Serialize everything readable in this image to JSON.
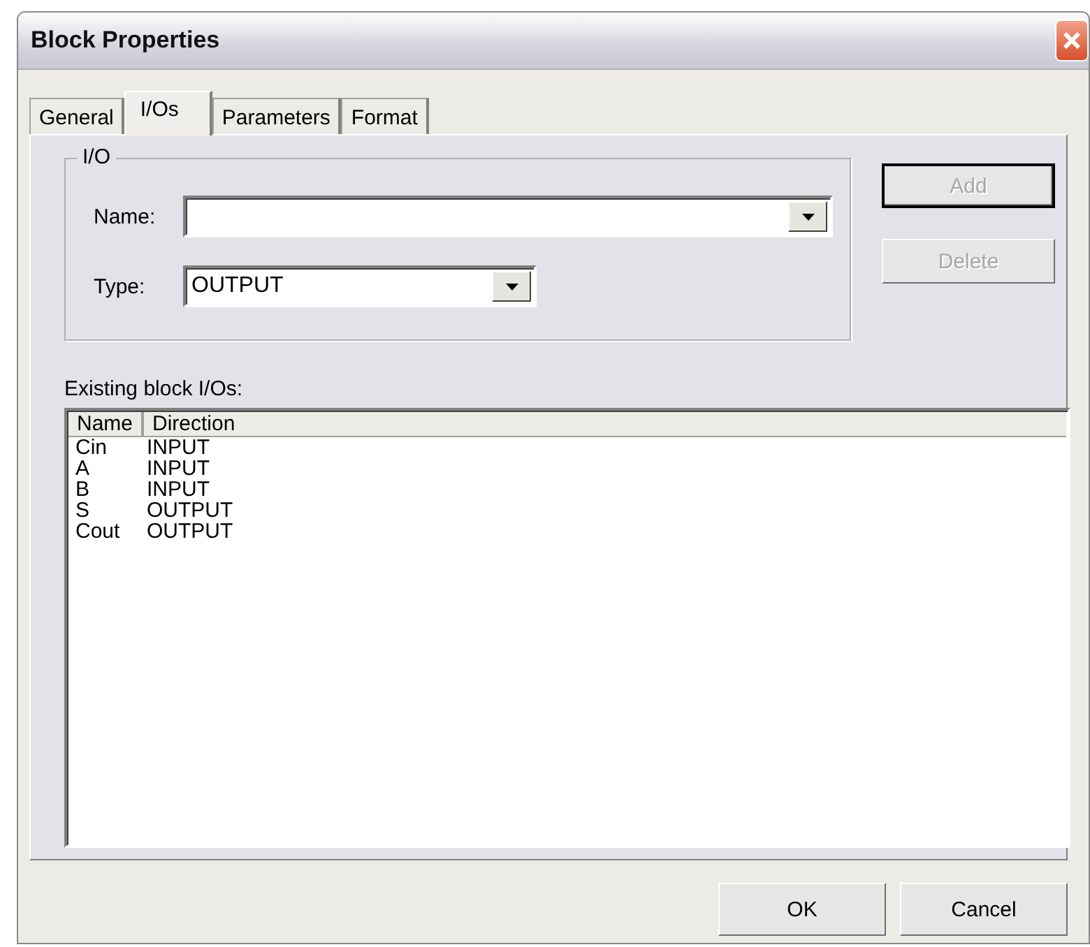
{
  "window": {
    "title": "Block Properties"
  },
  "tabs": [
    {
      "label": "General",
      "selected": false
    },
    {
      "label": "I/Os",
      "selected": true
    },
    {
      "label": "Parameters",
      "selected": false
    },
    {
      "label": "Format",
      "selected": false
    }
  ],
  "io_group": {
    "title": "I/O",
    "name_field": {
      "label": "Name:"
    },
    "type_field": {
      "label": "Type:",
      "value": "OUTPUT"
    }
  },
  "side_buttons": [
    {
      "label": "Add",
      "disabled": true,
      "default": true
    },
    {
      "label": "Delete",
      "disabled": true,
      "default": false
    }
  ],
  "list": {
    "label": "Existing block I/Os:",
    "columns": [
      "Name",
      "Direction"
    ],
    "rows": [
      [
        "Cin",
        "INPUT"
      ],
      [
        "A",
        "INPUT"
      ],
      [
        "B",
        "INPUT"
      ],
      [
        "S",
        "OUTPUT"
      ],
      [
        "Cout",
        "OUTPUT"
      ]
    ]
  },
  "buttons": [
    {
      "label": "OK"
    },
    {
      "label": "Cancel"
    }
  ]
}
